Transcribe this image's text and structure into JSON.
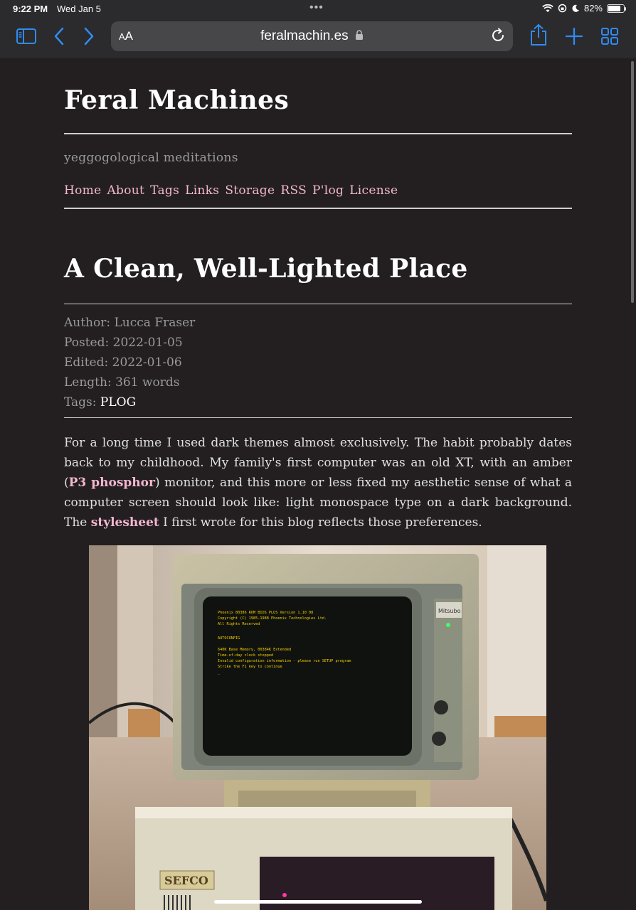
{
  "status": {
    "time": "9:22 PM",
    "date": "Wed Jan 5",
    "battery": "82%",
    "battery_level": 0.82
  },
  "toolbar": {
    "aa_label": "AA",
    "domain": "feralmachin.es"
  },
  "site": {
    "title": "Feral Machines",
    "subtitle": "yeggogological meditations",
    "nav": [
      "Home",
      "About",
      "Tags",
      "Links",
      "Storage",
      "RSS",
      "P'log",
      "License"
    ]
  },
  "post": {
    "title": "A Clean, Well-Lighted Place",
    "author_label": "Author:",
    "author": "Lucca Fraser",
    "posted_label": "Posted:",
    "posted": "2022-01-05",
    "edited_label": "Edited:",
    "edited": "2022-01-06",
    "length_label": "Length:",
    "length": "361 words",
    "tags_label": "Tags:",
    "tags": "PLOG",
    "para1_a": "For a long time I used dark themes almost exclusively. The habit probably dates back to my childhood. My family's first computer was an old XT, with an amber (",
    "para1_link1": "P3 phosphor",
    "para1_b": ") monitor, and this more or less fixed my aesthetic sense of what a computer screen should look like: light monospace type on a dark background. The ",
    "para1_link2": "stylesheet",
    "para1_c": " I first wrote for this blog reflects those preferences."
  },
  "photo": {
    "screen_lines": [
      "Phoenix 80386 ROM BIOS PLUS Version 1.10 08",
      "Copyright (C) 1985-1988 Phoenix Technologies Ltd.",
      "All Rights Reserved",
      "",
      "AUTOCONFIG",
      "",
      "640K Base Memory, 00384K Extended",
      "Time-of-day clock stopped",
      "Invalid configuration information - please run SETUP program",
      "  Strike the F1 key to continue",
      "_"
    ],
    "monitor_brand": "Mitsubo",
    "case_badge": "SEFCO"
  }
}
